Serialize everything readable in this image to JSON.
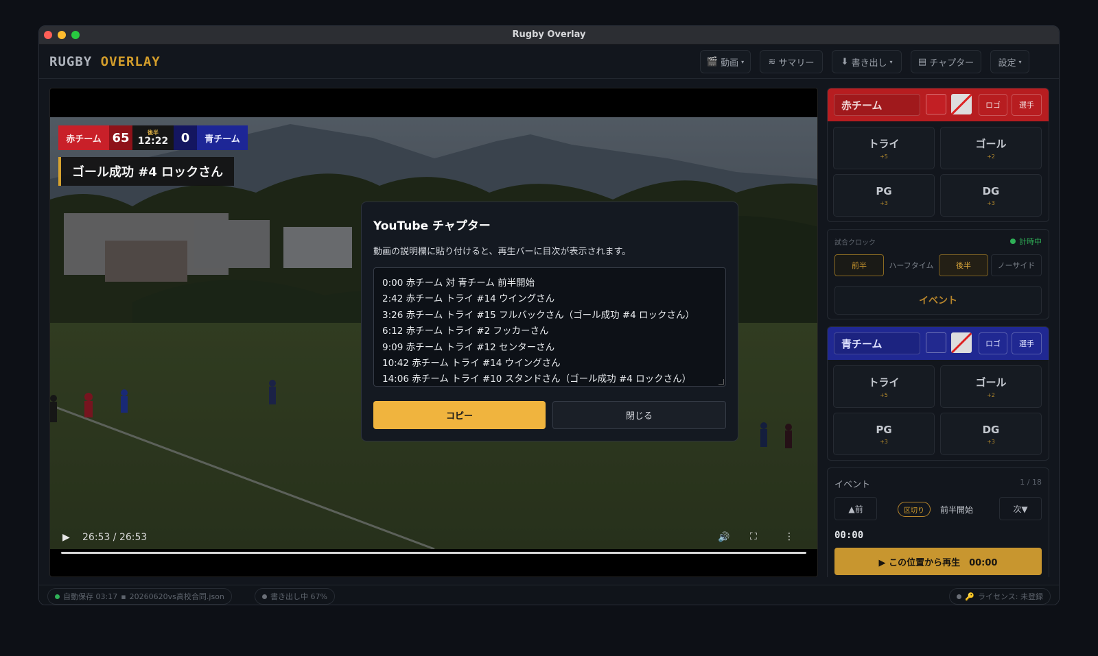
{
  "window": {
    "title": "Rugby Overlay"
  },
  "brand": {
    "word1": "RUGBY",
    "word2": "OVERLAY"
  },
  "nav": {
    "video": "動画",
    "summary": "サマリー",
    "export": "書き出し",
    "chapters": "チャプター",
    "settings": "設定"
  },
  "scoreboard": {
    "red_name": "赤チーム",
    "red_score": "65",
    "half": "後半",
    "clock": "12:22",
    "blue_score": "0",
    "blue_name": "青チーム"
  },
  "lower_third": "ゴール成功 #4 ロックさん",
  "player": {
    "time": "26:53 / 26:53"
  },
  "modal": {
    "title": "YouTube チャプター",
    "description": "動画の説明欄に貼り付けると、再生バーに目次が表示されます。",
    "chapters": [
      "0:00 赤チーム 対 青チーム 前半開始",
      "2:42 赤チーム トライ #14 ウイングさん",
      "3:26 赤チーム トライ #15 フルバックさん（ゴール成功 #4 ロックさん）",
      "6:12 赤チーム トライ #2 フッカーさん",
      "9:09 赤チーム トライ #12 センターさん",
      "10:42 赤チーム トライ #14 ウイングさん",
      "14:06 赤チーム トライ #10 スタンドさん（ゴール成功 #4 ロックさん）"
    ],
    "copy": "コピー",
    "close": "閉じる"
  },
  "red_team": {
    "name": "赤チーム",
    "color": "#b71d20",
    "logo": "ロゴ",
    "players": "選手",
    "try": "トライ",
    "try_pts": "+5",
    "goal": "ゴール",
    "goal_pts": "+2",
    "pg": "PG",
    "pg_pts": "+3",
    "dg": "DG",
    "dg_pts": "+3"
  },
  "clock_panel": {
    "label": "試合クロック",
    "status": "計時中",
    "phases": [
      "前半",
      "ハーフタイム",
      "後半",
      "ノーサイド"
    ],
    "event": "イベント"
  },
  "blue_team": {
    "name": "青チーム",
    "color": "#202892",
    "logo": "ロゴ",
    "players": "選手",
    "try": "トライ",
    "try_pts": "+5",
    "goal": "ゴール",
    "goal_pts": "+2",
    "pg": "PG",
    "pg_pts": "+3",
    "dg": "DG",
    "dg_pts": "+3"
  },
  "events": {
    "title": "イベント",
    "count": "1 / 18",
    "prev": "▲前",
    "next": "次▼",
    "tag": "区切り",
    "text": "前半開始",
    "time": "00:00",
    "play": "▶ この位置から再生　00:00"
  },
  "status": {
    "autosave": "自動保存 03:17",
    "file": "20260620vs高校合同.json",
    "export": "書き出し中 67%",
    "license": "ライセンス: 未登録"
  }
}
